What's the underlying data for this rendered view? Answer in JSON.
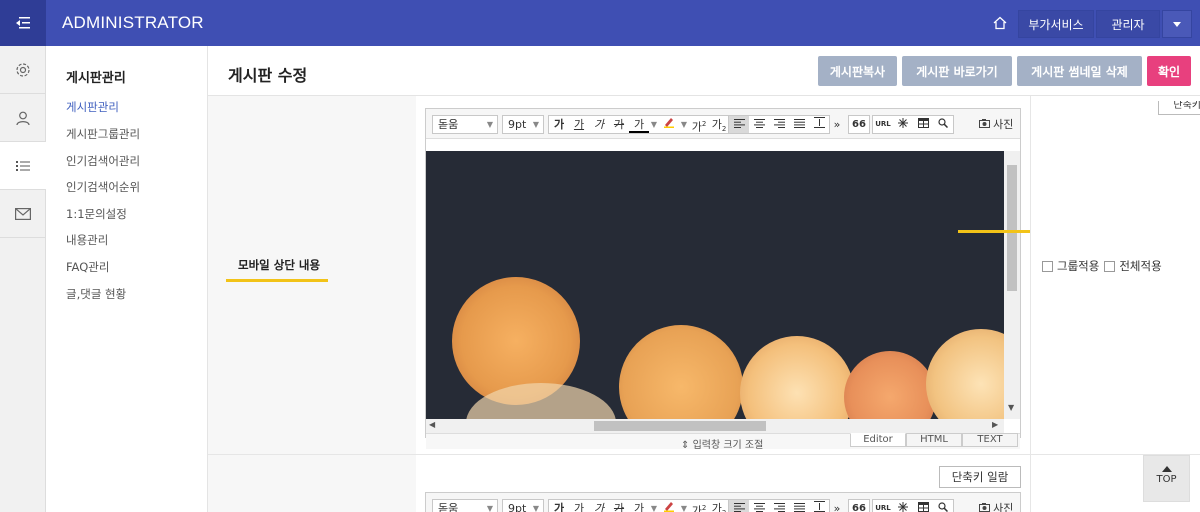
{
  "header": {
    "title": "ADMINISTRATOR",
    "service_label": "부가서비스",
    "admin_label": "관리자",
    "icons": [
      "menu-collapse-icon",
      "home-icon",
      "caret-down-icon"
    ]
  },
  "iconbar": {
    "items": [
      "settings-icon",
      "user-icon",
      "list-icon",
      "mail-icon"
    ],
    "active": "list-icon"
  },
  "menu": {
    "title": "게시판관리",
    "items": [
      {
        "label": "게시판관리",
        "active": true
      },
      {
        "label": "게시판그룹관리"
      },
      {
        "label": "인기검색어관리"
      },
      {
        "label": "인기검색어순위"
      },
      {
        "label": "1:1문의설정"
      },
      {
        "label": "내용관리"
      },
      {
        "label": "FAQ관리"
      },
      {
        "label": "글,댓글 현황"
      }
    ]
  },
  "page": {
    "title": "게시판 수정",
    "buttons": {
      "copy": "게시판복사",
      "goto": "게시판 바로가기",
      "thumb_delete": "게시판 썸네일 삭제",
      "confirm": "확인"
    }
  },
  "form": {
    "field_label": "모바일 상단 내용",
    "options": {
      "group_apply": "그룹적용",
      "all_apply": "전체적용"
    },
    "shortcut_label": "단축키 일람",
    "shortcut_label_partial": "단축키 일람"
  },
  "editor": {
    "font": "돋움",
    "size": "9pt",
    "format_buttons": [
      "가",
      "가",
      "가",
      "가",
      "가"
    ],
    "super_sub": [
      "가",
      "가"
    ],
    "quote": "66",
    "url": "URL",
    "photo_label": "사진",
    "resize_label": "입력창 크기 조절",
    "tabs": [
      "Editor",
      "HTML",
      "TEXT"
    ],
    "active_tab": "Editor"
  },
  "scroll_top": "TOP",
  "colors": {
    "header": "#3f4fb3",
    "header_dark": "#2f3d96",
    "button_gray": "#a4b1c6",
    "button_pink": "#e8407e",
    "highlight": "#f2c318",
    "menu_active": "#3f5fbf"
  }
}
